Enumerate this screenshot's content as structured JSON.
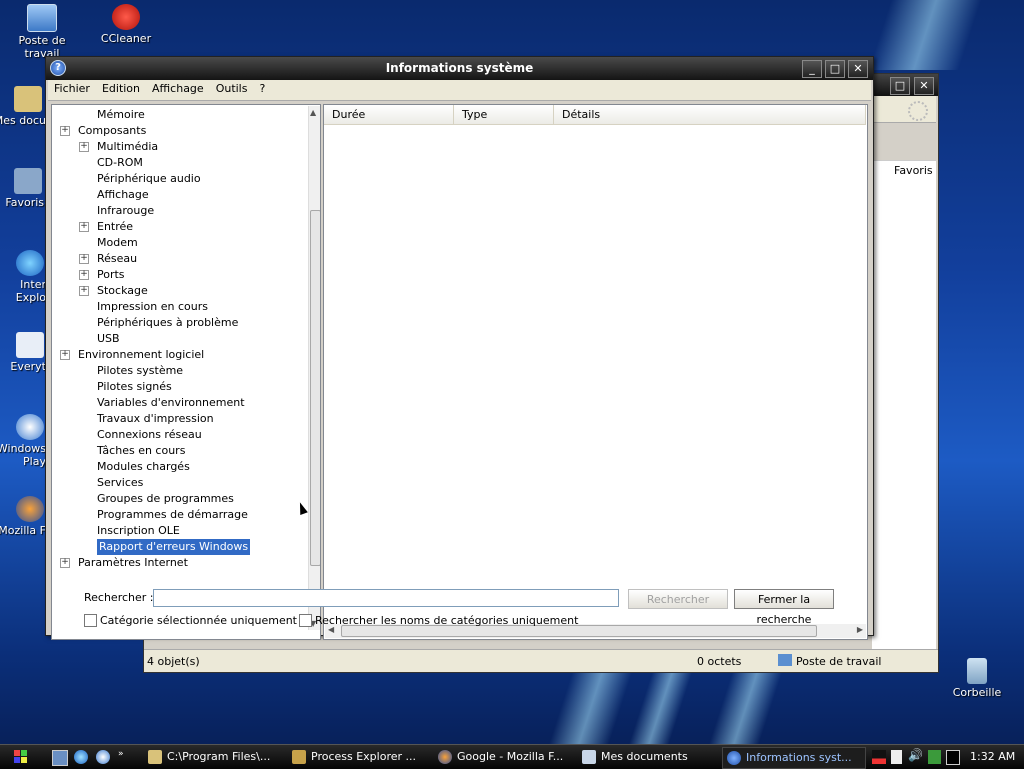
{
  "desktop": {
    "icons": [
      {
        "label": "Poste de travail"
      },
      {
        "label": "CCleaner"
      },
      {
        "label": "Mes docu"
      },
      {
        "label": "Favoris"
      },
      {
        "label": "Inter Explo"
      },
      {
        "label": "Everyt"
      },
      {
        "label": "Windows Play"
      },
      {
        "label": "Mozilla F"
      },
      {
        "label": "Corbeille"
      }
    ]
  },
  "back_window": {
    "favoris_label": "Favoris",
    "status_items": "4 objet(s)",
    "status_size": "0 octets",
    "status_location": "Poste de travail"
  },
  "window": {
    "title": "Informations système",
    "menu": [
      "Fichier",
      "Edition",
      "Affichage",
      "Outils",
      "?"
    ],
    "tree": [
      {
        "label": "Mémoire",
        "level": 2,
        "expander": false
      },
      {
        "label": "Composants",
        "level": 1,
        "expander": true
      },
      {
        "label": "Multimédia",
        "level": 2,
        "expander": true
      },
      {
        "label": "CD-ROM",
        "level": 2,
        "expander": false
      },
      {
        "label": "Périphérique audio",
        "level": 2,
        "expander": false
      },
      {
        "label": "Affichage",
        "level": 2,
        "expander": false
      },
      {
        "label": "Infrarouge",
        "level": 2,
        "expander": false
      },
      {
        "label": "Entrée",
        "level": 2,
        "expander": true
      },
      {
        "label": "Modem",
        "level": 2,
        "expander": false
      },
      {
        "label": "Réseau",
        "level": 2,
        "expander": true
      },
      {
        "label": "Ports",
        "level": 2,
        "expander": true
      },
      {
        "label": "Stockage",
        "level": 2,
        "expander": true
      },
      {
        "label": "Impression en cours",
        "level": 2,
        "expander": false
      },
      {
        "label": "Périphériques à problème",
        "level": 2,
        "expander": false
      },
      {
        "label": "USB",
        "level": 2,
        "expander": false
      },
      {
        "label": "Environnement logiciel",
        "level": 1,
        "expander": true
      },
      {
        "label": "Pilotes système",
        "level": 2,
        "expander": false
      },
      {
        "label": "Pilotes signés",
        "level": 2,
        "expander": false
      },
      {
        "label": "Variables d'environnement",
        "level": 2,
        "expander": false
      },
      {
        "label": "Travaux d'impression",
        "level": 2,
        "expander": false
      },
      {
        "label": "Connexions réseau",
        "level": 2,
        "expander": false
      },
      {
        "label": "Tâches en cours",
        "level": 2,
        "expander": false
      },
      {
        "label": "Modules chargés",
        "level": 2,
        "expander": false
      },
      {
        "label": "Services",
        "level": 2,
        "expander": false
      },
      {
        "label": "Groupes de programmes",
        "level": 2,
        "expander": false
      },
      {
        "label": "Programmes de démarrage",
        "level": 2,
        "expander": false
      },
      {
        "label": "Inscription OLE",
        "level": 2,
        "expander": false
      },
      {
        "label": "Rapport d'erreurs Windows",
        "level": 2,
        "expander": false,
        "selected": true
      },
      {
        "label": "Paramètres Internet",
        "level": 1,
        "expander": true
      }
    ],
    "columns": [
      "Durée",
      "Type",
      "Détails"
    ],
    "search": {
      "label": "Rechercher :",
      "value": "",
      "search_button": "Rechercher",
      "close_button": "Fermer la recherche",
      "checkbox_selected_category": "Catégorie sélectionnée uniquement",
      "checkbox_category_names": "Rechercher les noms de catégories uniquement"
    }
  },
  "taskbar": {
    "items": [
      {
        "label": "C:\\Program Files\\..."
      },
      {
        "label": "Process Explorer ..."
      },
      {
        "label": "Google - Mozilla F..."
      },
      {
        "label": "Mes documents"
      },
      {
        "label": "Informations syst..."
      }
    ],
    "clock": "1:32 AM"
  }
}
